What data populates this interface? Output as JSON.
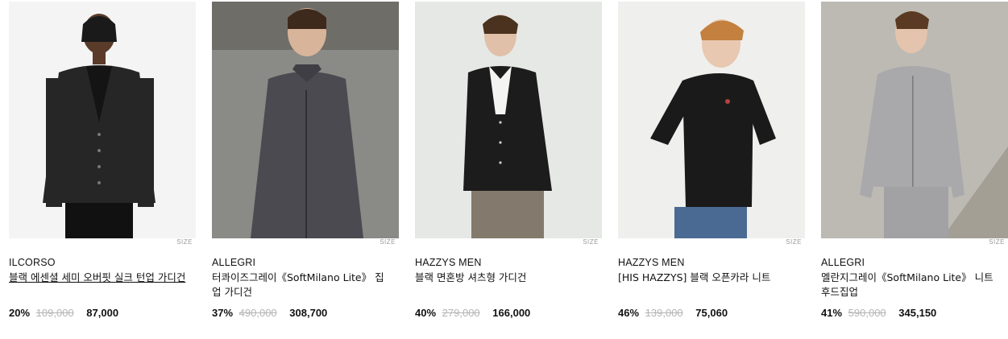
{
  "products": [
    {
      "brand": "ILCORSO",
      "name": "블랙 에센셜 세미 오버핏 실크 턴업 가디건",
      "size_label": "SIZE",
      "discount": "20%",
      "original_price": "109,000",
      "final_price": "87,000",
      "hovered": true,
      "colors": {
        "bg": "#f4f4f4",
        "garment": "#262626"
      }
    },
    {
      "brand": "ALLEGRI",
      "name": "터콰이즈그레이《SoftMilano Lite》 집업 가디건",
      "size_label": "SIZE",
      "discount": "37%",
      "original_price": "490,000",
      "final_price": "308,700",
      "hovered": false,
      "colors": {
        "bg": "#8a8a86",
        "garment": "#4a4a50"
      }
    },
    {
      "brand": "HAZZYS MEN",
      "name": "블랙 면혼방 셔츠형 가디건",
      "size_label": "SIZE",
      "discount": "40%",
      "original_price": "279,000",
      "final_price": "166,000",
      "hovered": false,
      "colors": {
        "bg": "#e6e8e6",
        "garment": "#1c1c1c"
      }
    },
    {
      "brand": "HAZZYS MEN",
      "name": "[HIS HAZZYS] 블랙 오픈카라 니트",
      "size_label": "SIZE",
      "discount": "46%",
      "original_price": "139,000",
      "final_price": "75,060",
      "hovered": false,
      "colors": {
        "bg": "#efefed",
        "garment": "#1a1a1a"
      }
    },
    {
      "brand": "ALLEGRI",
      "name": "멜란지그레이《SoftMilano Lite》 니트 후드집업",
      "size_label": "SIZE",
      "discount": "41%",
      "original_price": "590,000",
      "final_price": "345,150",
      "hovered": false,
      "colors": {
        "bg": "#bdbab4",
        "garment": "#a9a9ab"
      }
    }
  ]
}
